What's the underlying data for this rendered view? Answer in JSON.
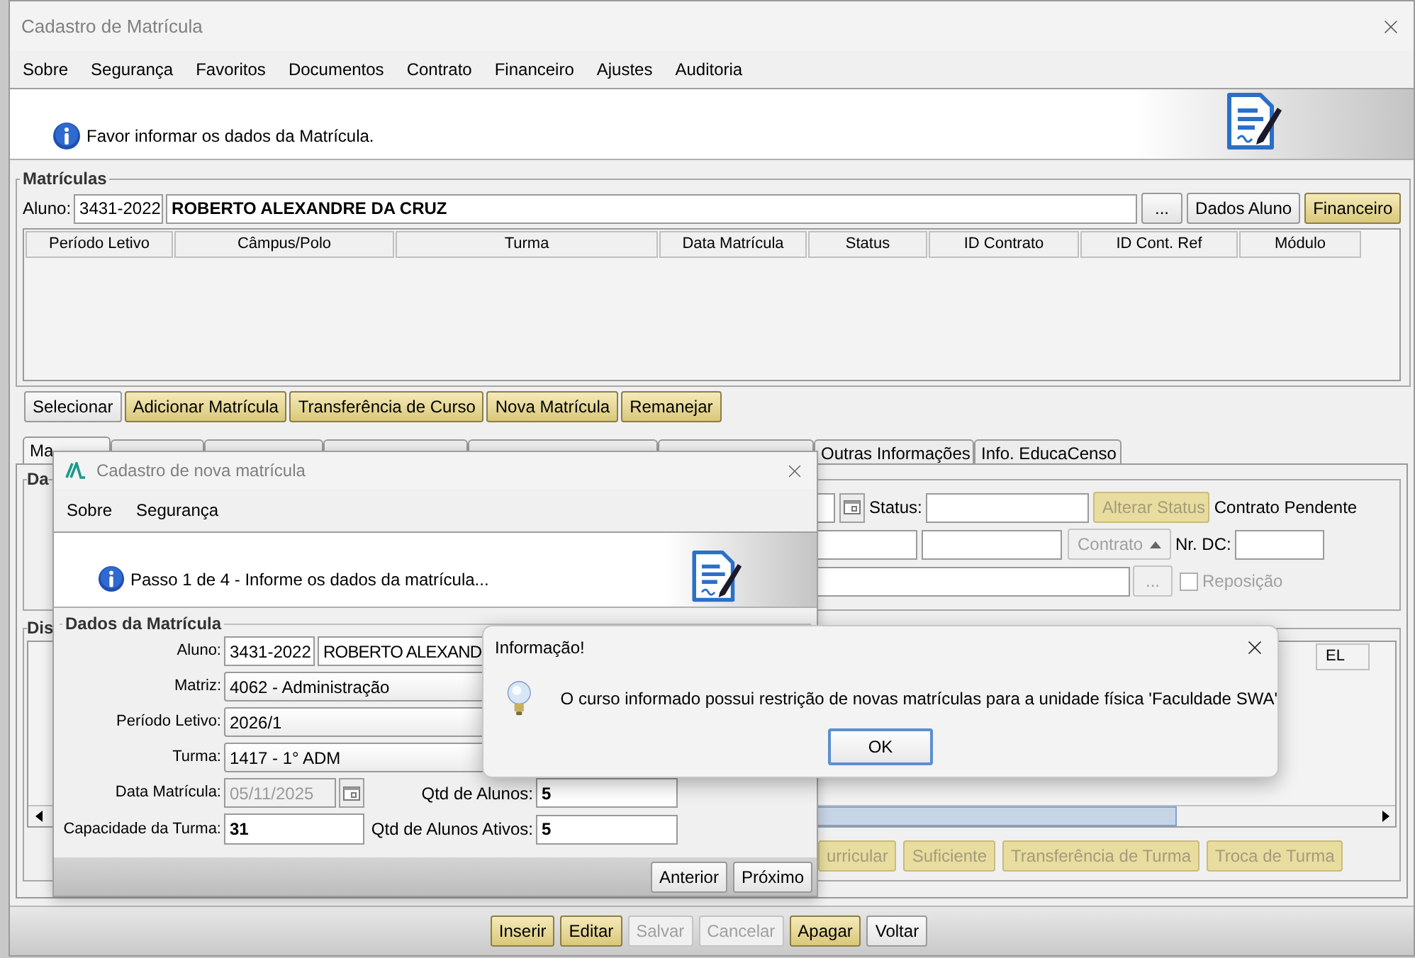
{
  "window": {
    "title": "Cadastro de Matrícula"
  },
  "menu": [
    "Sobre",
    "Segurança",
    "Favoritos",
    "Documentos",
    "Contrato",
    "Financeiro",
    "Ajustes",
    "Auditoria"
  ],
  "banner": {
    "message": "Favor informar os dados da Matrícula."
  },
  "matriculas": {
    "title": "Matrículas",
    "aluno_label": "Aluno:",
    "aluno_code": "3431-2022",
    "aluno_name": "ROBERTO ALEXANDRE DA CRUZ",
    "buttons": [
      {
        "label": "...",
        "kind": "plain",
        "disabled": false
      },
      {
        "label": "Dados Aluno",
        "kind": "plain",
        "disabled": false
      },
      {
        "label": "Financeiro",
        "kind": "accent",
        "disabled": false
      }
    ],
    "columns": [
      "Período Letivo",
      "Câmpus/Polo",
      "Turma",
      "Data Matrícula",
      "Status",
      "ID Contrato",
      "ID Cont. Ref",
      "Módulo"
    ]
  },
  "actions": [
    {
      "label": "Selecionar",
      "kind": "plain",
      "disabled": false
    },
    {
      "label": "Adicionar Matrícula",
      "kind": "accent",
      "disabled": false
    },
    {
      "label": "Transferência de Curso",
      "kind": "accent",
      "disabled": false
    },
    {
      "label": "Nova Matrícula",
      "kind": "accent",
      "disabled": false
    },
    {
      "label": "Remanejar",
      "kind": "accent",
      "disabled": false
    }
  ],
  "tabs": [
    {
      "label": "Ma",
      "selected": true
    },
    {
      "selected": false
    },
    {
      "selected": false
    },
    {
      "selected": false
    },
    {
      "selected": false
    },
    {
      "selected": false
    },
    {
      "label": "Outras Informações",
      "selected": false
    },
    {
      "label": "Info. EducaCenso",
      "selected": false
    }
  ],
  "dados": {
    "title": "Da",
    "status_label": "Status:",
    "alterar_status": {
      "label": "Alterar Status",
      "disabled": true
    },
    "contrato_pendente": "Contrato Pendente",
    "contrato_button": {
      "label": "Contrato",
      "disabled": true
    },
    "nr_dc_label": "Nr. DC:",
    "ellipsis": {
      "label": "...",
      "disabled": true
    },
    "reposicao": {
      "label": "Reposição",
      "checked": false,
      "disabled": true
    }
  },
  "disciplinas": {
    "title": "Dis",
    "columns": [
      "EL"
    ],
    "buttons": [
      {
        "label": "urricular",
        "disabled": true
      },
      {
        "label": "Suficiente",
        "disabled": true
      },
      {
        "label": "Transferência de Turma",
        "disabled": true
      },
      {
        "label": "Troca de Turma",
        "disabled": true
      }
    ]
  },
  "footer_buttons": [
    {
      "label": "Inserir",
      "kind": "accent",
      "disabled": false
    },
    {
      "label": "Editar",
      "kind": "accent",
      "disabled": false
    },
    {
      "label": "Salvar",
      "kind": "plain",
      "disabled": true
    },
    {
      "label": "Cancelar",
      "kind": "plain",
      "disabled": true
    },
    {
      "label": "Apagar",
      "kind": "accent",
      "disabled": false
    },
    {
      "label": "Voltar",
      "kind": "plain",
      "disabled": false
    }
  ],
  "modal": {
    "title": "Cadastro de nova matrícula",
    "menu": [
      "Sobre",
      "Segurança"
    ],
    "message": "Passo 1 de 4 - Informe os dados da matrícula...",
    "group_title": "Dados da Matrícula",
    "aluno_label": "Aluno:",
    "aluno_code": "3431-2022",
    "aluno_name": "ROBERTO ALEXAND",
    "matriz_label": "Matriz:",
    "matriz": "4062 - Administração",
    "periodo_label": "Período Letivo:",
    "periodo": "2026/1",
    "turma_label": "Turma:",
    "turma": "1417 - 1° ADM",
    "data_label": "Data Matrícula:",
    "data": {
      "value": "05/11/2025",
      "disabled": true
    },
    "qtd_label": "Qtd de Alunos:",
    "qtd": "5",
    "capacidade_label": "Capacidade da Turma:",
    "capacidade": "31",
    "ativos_label": "Qtd de Alunos Ativos:",
    "ativos": "5",
    "buttons": [
      "Anterior",
      "Próximo"
    ]
  },
  "dialog": {
    "title": "Informação!",
    "message": "O curso informado possui restrição de novas matrículas para a unidade física 'Faculdade SWA'",
    "button": "OK"
  }
}
